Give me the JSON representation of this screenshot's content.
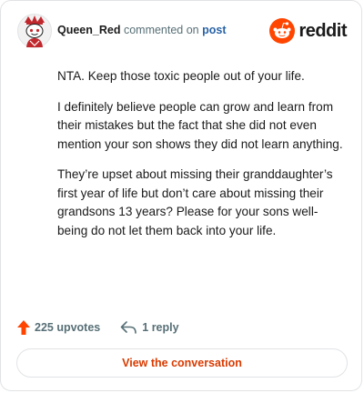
{
  "header": {
    "username": "Queen_Red",
    "action_text": "commented on",
    "post_link": "post",
    "brand_wordmark": "reddit",
    "avatar_icon": "snoo-avatar-icon",
    "brand_icon": "reddit-snoo-icon"
  },
  "comment": {
    "paragraphs": [
      "NTA. Keep those toxic people out of your life.",
      "I definitely believe people can grow and learn from their mistakes but the fact that she did not even mention your son shows they did not learn anything.",
      "They’re upset about missing their granddaughter’s first year of life but don’t care about missing their grandsons 13 years? Please for your sons well-being do not let them back into your life."
    ]
  },
  "actions": {
    "upvotes": "225 upvotes",
    "replies": "1 reply",
    "upvote_icon": "upvote-arrow-icon",
    "reply_icon": "reply-arrow-icon"
  },
  "cta": {
    "label": "View the conversation"
  },
  "colors": {
    "brand": "#ff4500",
    "link": "#2a63a6",
    "cta_text": "#d93a00",
    "muted": "#576f76",
    "text": "#1a1a1b",
    "border": "#e1e3e5"
  }
}
